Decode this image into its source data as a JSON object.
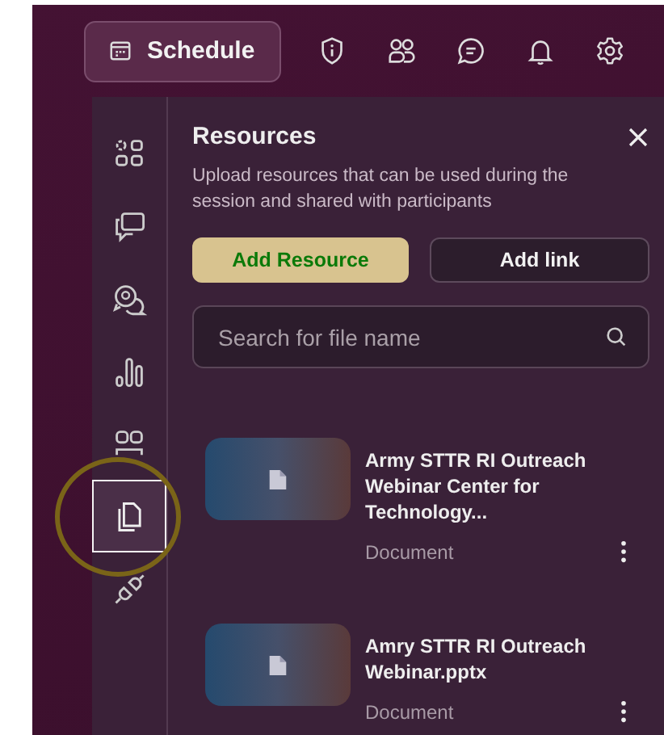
{
  "top_bar": {
    "schedule_button": "Schedule"
  },
  "sidebar": {
    "items": [
      {
        "selected": false,
        "circled": false
      },
      {
        "selected": false,
        "circled": false
      },
      {
        "selected": false,
        "circled": false
      },
      {
        "selected": false,
        "circled": false
      },
      {
        "selected": false,
        "circled": false
      },
      {
        "selected": true,
        "circled": true
      },
      {
        "selected": false,
        "circled": false
      }
    ]
  },
  "panel": {
    "title": "Resources",
    "description": "Upload resources that can be used during the session and shared with participants",
    "buttons": [
      {
        "label": "Add Resource",
        "kind": "primary"
      },
      {
        "label": "Add link",
        "kind": "secondary"
      }
    ],
    "search": {
      "placeholder": "Search for file name"
    },
    "files": [
      {
        "name": "Army STTR RI Outreach Webinar Center for Technology...",
        "type": "Document"
      },
      {
        "name": "Amry STTR RI Outreach Webinar.pptx",
        "type": "Document"
      }
    ]
  }
}
